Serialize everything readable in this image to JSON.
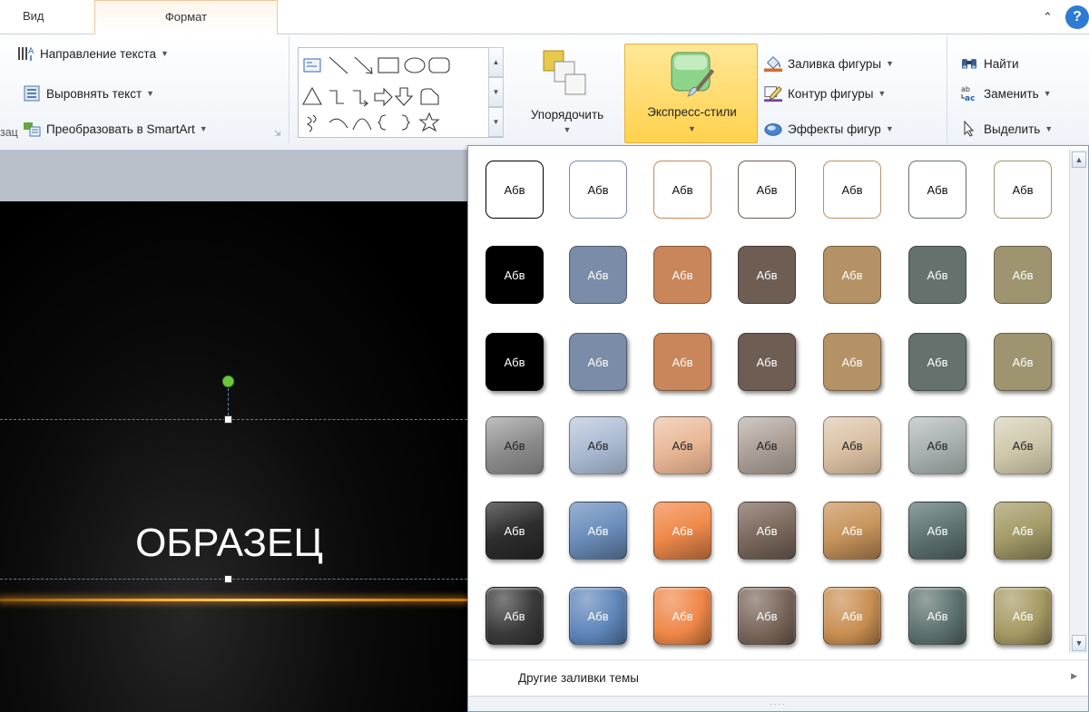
{
  "tabs": [
    {
      "label": "Вид",
      "active": false
    },
    {
      "label": "Формат",
      "active": true
    }
  ],
  "ribbon": {
    "paragraph": {
      "text_direction": "Направление текста",
      "align_text": "Выровнять текст",
      "convert_smartart": "Преобразовать в SmartArt",
      "group_label_partial": "зац"
    },
    "drawing": {
      "arrange": "Упорядочить",
      "quick_styles": "Экспресс-стили",
      "shape_fill": "Заливка фигуры",
      "shape_outline": "Контур фигуры",
      "shape_effects": "Эффекты фигур"
    },
    "editing": {
      "find": "Найти",
      "replace": "Заменить",
      "select": "Выделить"
    }
  },
  "slide": {
    "title": "ОБРАЗЕЦ"
  },
  "quick_styles_gallery": {
    "tile_text": "Абв",
    "rows": [
      {
        "kind": "outline",
        "colors": [
          "#000000",
          "#7a8ca8",
          "#c9865a",
          "#6e5d53",
          "#b59266",
          "#65716d",
          "#9e9570"
        ]
      },
      {
        "kind": "solid-flat",
        "colors": [
          "#000000",
          "#7a8ca8",
          "#c9865a",
          "#6e5d53",
          "#b59266",
          "#65716d",
          "#9e9570"
        ]
      },
      {
        "kind": "solid-shadow",
        "colors": [
          "#000000",
          "#7a8ca8",
          "#c9865a",
          "#6e5d53",
          "#b59266",
          "#65716d",
          "#9e9570"
        ]
      },
      {
        "kind": "gradient-light",
        "colors": [
          "#8a8a8a",
          "#a9b9d1",
          "#e8b594",
          "#a99d94",
          "#d8bea0",
          "#a5afad",
          "#cdc6a9"
        ]
      },
      {
        "kind": "gradient-strong",
        "colors": [
          "#2e2e2e",
          "#6d8fbd",
          "#f08a4b",
          "#7d6a5e",
          "#c9955d",
          "#5f7574",
          "#a69d6a"
        ]
      },
      {
        "kind": "gradient-bevel",
        "colors": [
          "#3a3a3a",
          "#5f86ba",
          "#ef8748",
          "#7a665a",
          "#c98f52",
          "#5d7270",
          "#a59a63"
        ]
      }
    ],
    "more_fills": "Другие заливки темы"
  }
}
